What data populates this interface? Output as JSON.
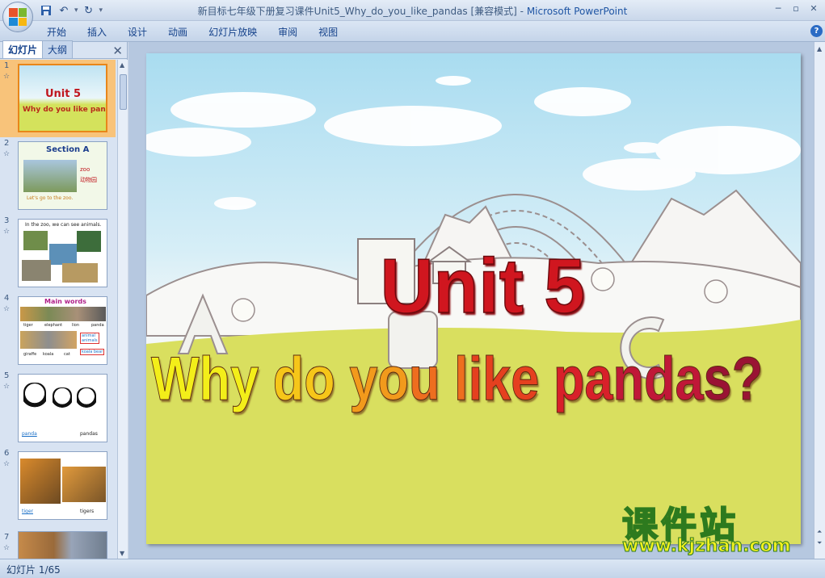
{
  "window": {
    "title": "新目标七年级下册复习课件Unit5_Why_do_you_like_pandas [兼容模式]",
    "title_sep": " - ",
    "app_name": "Microsoft PowerPoint"
  },
  "ribbon": {
    "tabs": [
      "开始",
      "插入",
      "设计",
      "动画",
      "幻灯片放映",
      "审阅",
      "视图"
    ]
  },
  "left_pane": {
    "tabs": [
      "幻灯片",
      "大纲"
    ],
    "slides": [
      {
        "num": "1",
        "title": "Unit 5",
        "subtitle": "Why do you like pandas?"
      },
      {
        "num": "2",
        "title": "Section A",
        "text1": "zoo",
        "text2": "动物园",
        "caption": "Let's go to the zoo."
      },
      {
        "num": "3",
        "caption": "In the zoo, we can see animals."
      },
      {
        "num": "4",
        "title": "Main words",
        "row1": [
          "tiger",
          "elephant",
          "lion",
          "panda"
        ],
        "row2": [
          "giraffe",
          "koala",
          "cat"
        ],
        "note1": "animal",
        "note2": "animals",
        "note3": "koala bear"
      },
      {
        "num": "5",
        "words": [
          "panda",
          "pandas"
        ]
      },
      {
        "num": "6",
        "words": [
          "tiger",
          "tigers"
        ]
      },
      {
        "num": "7"
      }
    ]
  },
  "slide": {
    "title": "Unit 5",
    "subtitle": "Why do you like pandas?",
    "letters": [
      "A",
      "B",
      "C"
    ]
  },
  "status": {
    "text": "幻灯片 1/65"
  },
  "watermark": {
    "logo": "课件站",
    "url": "www.kjzhan.com"
  }
}
